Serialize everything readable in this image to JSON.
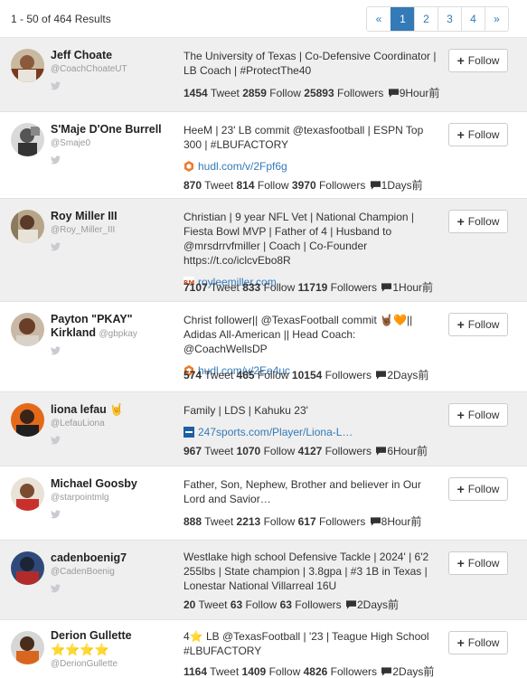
{
  "results_text": "1 - 50 of 464 Results",
  "pagination": {
    "prev": "«",
    "pages": [
      "1",
      "2",
      "3",
      "4"
    ],
    "next": "»",
    "active": "1"
  },
  "follow_label": "Follow",
  "labels": {
    "tweet": "Tweet",
    "follow": "Follow",
    "followers": "Followers"
  },
  "rows": [
    {
      "name": "Jeff Choate",
      "handle": "@CoachChoateUT",
      "bio": "The University of Texas | Co-Defensive Coordinator | LB Coach | #ProtectThe40",
      "tweets": "1454",
      "following": "2859",
      "followers": "25893",
      "time": "9Hour前"
    },
    {
      "name": "S'Maje D'One Burrell",
      "handle": "@Smaje0",
      "bio": "HeeM | 23' LB commit @texasfootball | ESPN Top 300 | #LBUFACTORY",
      "link": "hudl.com/v/2Fpf6g",
      "tweets": "870",
      "following": "814",
      "followers": "3970",
      "time": "1Days前"
    },
    {
      "name": "Roy Miller III",
      "handle": "@Roy_Miller_III",
      "bio": "Christian | 9 year NFL Vet | National Champion | Fiesta Bowl MVP | Father of 4 | Husband to @mrsdrrvfmiller | Coach | Co-Founder https://t.co/iclcvEbo8R",
      "link": "royleemiller.com",
      "tweets": "7107",
      "following": "833",
      "followers": "11719",
      "time": "1Hour前"
    },
    {
      "name": "Payton \"PKAY\" Kirkland",
      "handle": "@gbpkay",
      "bio": "Christ follower|| @TexasFootball commit 🤘🏾🧡|| Adidas All-American || Head Coach: @CoachWellsDP",
      "link": "hudl.com/v/2Ee4uc",
      "tweets": "574",
      "following": "465",
      "followers": "10154",
      "time": "2Days前"
    },
    {
      "name": "liona lefau",
      "name_emoji": "🤘",
      "handle": "@LefauLiona",
      "bio": "Family | LDS | Kahuku 23'",
      "link": "247sports.com/Player/Liona-L…",
      "tweets": "967",
      "following": "1070",
      "followers": "4127",
      "time": "6Hour前"
    },
    {
      "name": "Michael Goosby",
      "handle": "@starpointmlg",
      "bio": "Father, Son, Nephew, Brother and believer in Our Lord and Savior…",
      "tweets": "888",
      "following": "2213",
      "followers": "617",
      "time": "8Hour前"
    },
    {
      "name": "cadenboenig7",
      "handle": "@CadenBoenig",
      "bio": "Westlake high school Defensive Tackle | 2024' | 6'2 255lbs | State champion | 3.8gpa | #3 1B in Texas | Lonestar National Villarreal 16U",
      "tweets": "20",
      "following": "63",
      "followers": "63",
      "time": "2Days前"
    },
    {
      "name": "Derion Gullette",
      "name_stars": "⭐⭐⭐⭐",
      "handle": "@DerionGullette",
      "bio": "4⭐ LB @TexasFootball | '23 | Teague High School #LBUFACTORY",
      "tweets": "1164",
      "following": "1409",
      "followers": "4826",
      "time": "2Days前"
    }
  ],
  "colors": {
    "accent": "#337ab7",
    "row_alt": "#efefef",
    "link_icon": "#f07a28"
  },
  "icons": {
    "twitter": "twitter-bird-icon",
    "tweet_bubble": "speech-bubble-icon",
    "plus": "plus-icon"
  }
}
